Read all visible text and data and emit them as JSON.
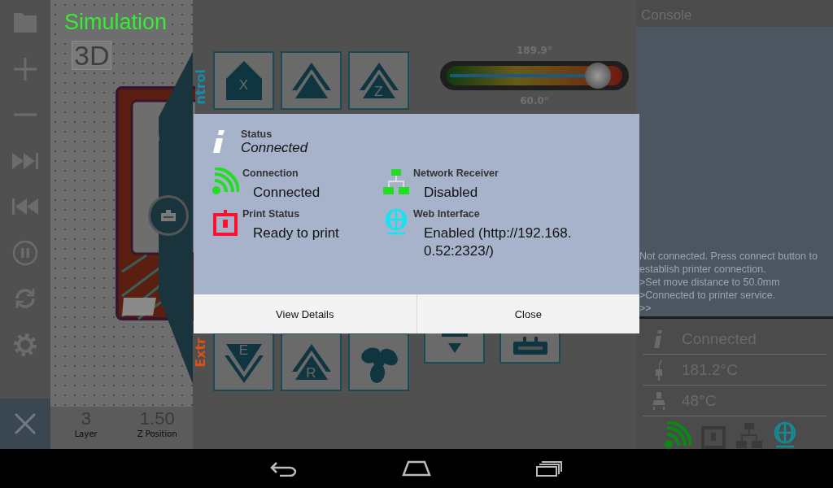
{
  "simulation": {
    "title": "Simulation",
    "view_badge": "3D",
    "stats": [
      {
        "value": "3",
        "label": "Layer"
      },
      {
        "value": "1.50",
        "label": "Z Position"
      }
    ]
  },
  "control": {
    "section_top": "ntrol",
    "section_bottom": "Extr",
    "top_buttons": [
      {
        "kind": "home",
        "label": "X"
      },
      {
        "kind": "home"
      },
      {
        "kind": "home",
        "label": "Z"
      }
    ],
    "bottom_buttons": [
      {
        "kind": "extrude",
        "label": "E"
      },
      {
        "kind": "retract",
        "label": "R"
      },
      {
        "kind": "fan"
      }
    ],
    "temperature": {
      "max": "189.9°",
      "min": "60.0°",
      "level": 0.8
    }
  },
  "console": {
    "title": "Console",
    "lines": [
      "Not connected. Press connect button to establish printer connection.",
      ">Set move distance to 50.0mm",
      ">Connected to printer service.",
      ">>"
    ],
    "status_rows": [
      {
        "kind": "info",
        "value": "Connected"
      },
      {
        "kind": "extruder",
        "value": "181.2°C"
      },
      {
        "kind": "bed",
        "value": "48°C"
      }
    ],
    "indicators": [
      {
        "kind": "connection",
        "color": "#0a8a14"
      },
      {
        "kind": "printer",
        "color": "#3a3a3a"
      },
      {
        "kind": "network",
        "color": "#3a3a3a"
      },
      {
        "kind": "web",
        "color": "#138a94"
      }
    ]
  },
  "dialog": {
    "status_label": "Status",
    "status_value": "Connected",
    "items": [
      {
        "kind": "connection",
        "label": "Connection",
        "value": "Connected",
        "color": "#22dd22"
      },
      {
        "kind": "network",
        "label": "Network Receiver",
        "value": "Disabled",
        "color": "#22dd22"
      },
      {
        "kind": "printer",
        "label": "Print Status",
        "value": "Ready to print",
        "color": "#ff1030"
      },
      {
        "kind": "web",
        "label": "Web Interface",
        "value": "Enabled (http://192.168.0.52:2323/)",
        "color": "#11e4f4"
      }
    ],
    "buttons": [
      "View Details",
      "Close"
    ]
  }
}
